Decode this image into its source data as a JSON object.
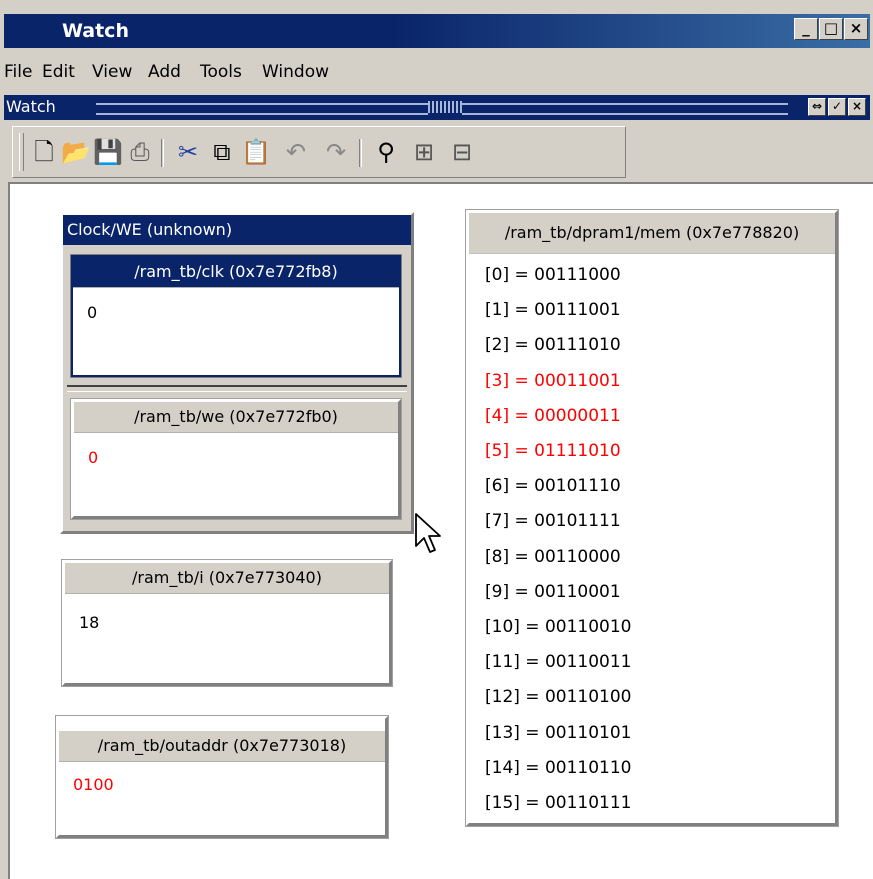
{
  "window": {
    "title": "Watch",
    "min_label": "_",
    "max_label": "□",
    "close_label": "×"
  },
  "menu": [
    "File",
    "Edit",
    "View",
    "Add",
    "Tools",
    "Window"
  ],
  "subwindow": {
    "title": "Watch"
  },
  "toolbar": {
    "icons": [
      "new-file-icon",
      "open-folder-icon",
      "save-icon",
      "print-icon",
      "cut-icon",
      "copy-icon",
      "paste-icon",
      "undo-icon",
      "redo-icon",
      "find-icon",
      "expand-icon",
      "collapse-icon"
    ]
  },
  "colors": {
    "title_bg": "#0a246a",
    "changed_value": "#ff0000",
    "normal_value": "#000000"
  },
  "group": {
    "title": "Clock/WE (unknown)",
    "clk": {
      "label": "/ram_tb/clk (0x7e772fb8)",
      "value": "0"
    },
    "we": {
      "label": "/ram_tb/we (0x7e772fb0)",
      "value": "0"
    }
  },
  "i_panel": {
    "label": "/ram_tb/i (0x7e773040)",
    "value": "18"
  },
  "outaddr_panel": {
    "label": "/ram_tb/outaddr (0x7e773018)",
    "value": "0100"
  },
  "mem_panel": {
    "label": "/ram_tb/dpram1/mem (0x7e778820)",
    "rows": [
      {
        "text": "[0] = 00111000",
        "changed": false
      },
      {
        "text": "[1] = 00111001",
        "changed": false
      },
      {
        "text": "[2] = 00111010",
        "changed": false
      },
      {
        "text": "[3] = 00011001",
        "changed": true
      },
      {
        "text": "[4] = 00000011",
        "changed": true
      },
      {
        "text": "[5] = 01111010",
        "changed": true
      },
      {
        "text": "[6] = 00101110",
        "changed": false
      },
      {
        "text": "[7] = 00101111",
        "changed": false
      },
      {
        "text": "[8] = 00110000",
        "changed": false
      },
      {
        "text": "[9] = 00110001",
        "changed": false
      },
      {
        "text": "[10] = 00110010",
        "changed": false
      },
      {
        "text": "[11] = 00110011",
        "changed": false
      },
      {
        "text": "[12] = 00110100",
        "changed": false
      },
      {
        "text": "[13] = 00110101",
        "changed": false
      },
      {
        "text": "[14] = 00110110",
        "changed": false
      },
      {
        "text": "[15] = 00110111",
        "changed": false
      }
    ]
  }
}
